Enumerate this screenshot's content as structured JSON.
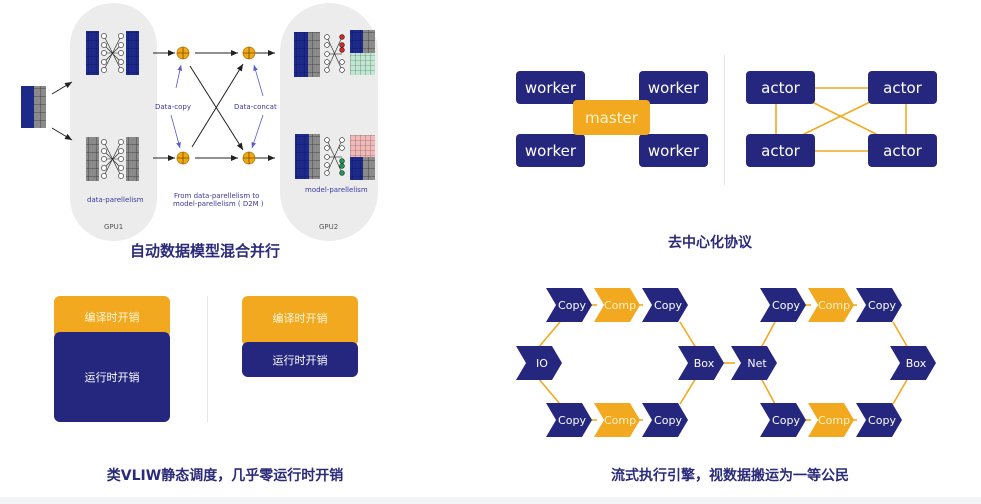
{
  "panels": {
    "hybrid_parallel": {
      "caption": "自动数据模型混合并行",
      "labels": {
        "data_copy": "Data-copy",
        "data_concat": "Data-concat",
        "data_parallelism": "data-parellelism",
        "model_parallelism": "model-parellelism",
        "d2m_line1": "From data-parellelism to",
        "d2m_line2": "model-parellelism ( D2M )",
        "gpu1": "GPU1",
        "gpu2": "GPU2"
      }
    },
    "decentralized": {
      "caption": "去中心化协议",
      "left": {
        "workers": [
          "worker",
          "worker",
          "worker",
          "worker"
        ],
        "master": "master"
      },
      "right": {
        "actors": [
          "actor",
          "actor",
          "actor",
          "actor"
        ]
      }
    },
    "overhead": {
      "caption": "类VLIW静态调度，几乎零运行时开销",
      "left": {
        "compile": "编译时开销",
        "runtime": "运行时开销"
      },
      "right": {
        "compile": "编译时开销",
        "runtime": "运行时开销"
      }
    },
    "streaming": {
      "caption": "流式执行引擎，视数据搬运为一等公民",
      "left": {
        "source": "IO",
        "sink": "Box",
        "top": [
          "Copy",
          "Comp",
          "Copy"
        ],
        "bottom": [
          "Copy",
          "Comp",
          "Copy"
        ]
      },
      "right": {
        "source": "Net",
        "sink": "Box",
        "top": [
          "Copy",
          "Comp",
          "Copy"
        ],
        "bottom": [
          "Copy",
          "Comp",
          "Copy"
        ]
      }
    }
  },
  "colors": {
    "navy": "#25277e",
    "gold": "#f2a91f",
    "caption": "#2b2b7a",
    "gpu_panel": "#ececec"
  }
}
